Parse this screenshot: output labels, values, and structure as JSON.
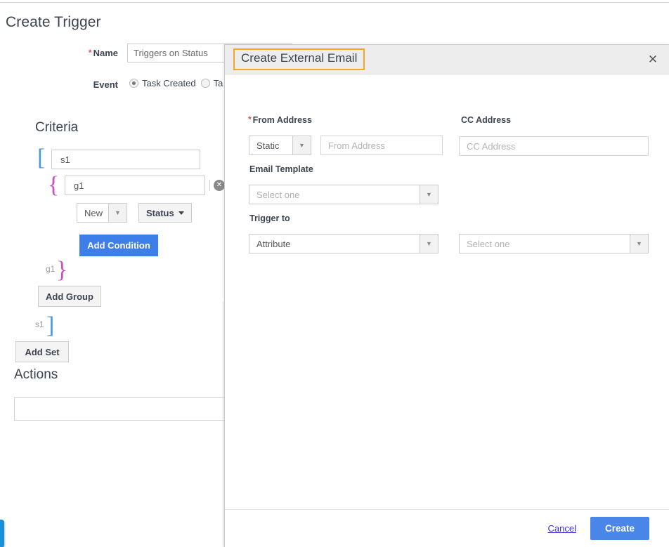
{
  "background": {
    "page_title": "Create Trigger",
    "name_field": {
      "label": "Name",
      "required_marker": "*",
      "value": "Triggers on Status"
    },
    "event_field": {
      "label": "Event",
      "options": [
        {
          "label": "Task Created",
          "selected": true
        },
        {
          "label": "Ta",
          "selected": false
        }
      ]
    },
    "criteria": {
      "heading": "Criteria",
      "open_set_bracket": "[",
      "close_set_bracket": "]",
      "open_group_bracket": "{",
      "close_group_bracket": "}",
      "set_value": "s1",
      "group_value": "g1",
      "set_tag": "s1",
      "group_tag": "g1",
      "delete_icon": "close-circle-icon",
      "condition_value": {
        "selected": "New"
      },
      "condition_attribute": "Status",
      "add_condition_label": "Add Condition",
      "add_group_label": "Add Group",
      "add_set_label": "Add Set"
    },
    "actions": {
      "heading": "Actions",
      "box_value": ""
    },
    "left_tab": "side-tab-handle",
    "accent_color": "#3d7ee8"
  },
  "dialog": {
    "title": "Create External Email",
    "title_highlight_color": "#f5a623",
    "close_icon": "close-icon",
    "fields": {
      "from_address": {
        "label": "From Address",
        "required_marker": "*",
        "type_selected": "Static",
        "input_placeholder": "From Address",
        "input_value": ""
      },
      "cc_address": {
        "label": "CC Address",
        "input_placeholder": "CC Address",
        "input_value": ""
      },
      "email_template": {
        "label": "Email Template",
        "placeholder": "Select one",
        "value": ""
      },
      "trigger_to": {
        "label": "Trigger to",
        "source_selected": "Attribute",
        "target_placeholder": "Select one",
        "target_value": ""
      }
    },
    "footer": {
      "cancel_label": "Cancel",
      "create_label": "Create",
      "create_color": "#4a86e8"
    }
  }
}
